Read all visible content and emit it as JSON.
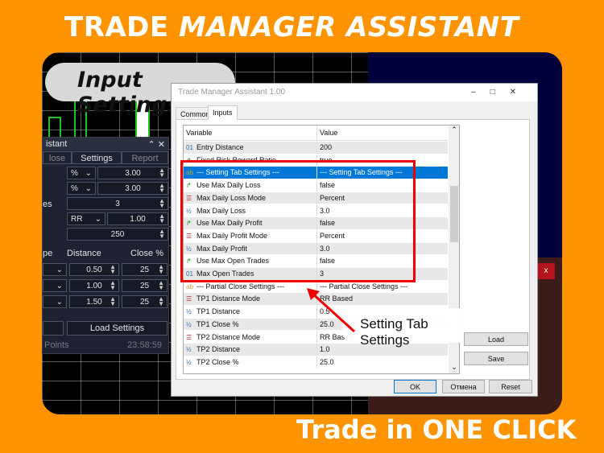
{
  "header": {
    "title_a": "TRADE",
    "title_b": "MANAGER ASSISTANT"
  },
  "footer": {
    "tagline": "Trade in ONE CLICK"
  },
  "badge": {
    "label": "Input Settings"
  },
  "callout": {
    "label": "Setting Tab Settings"
  },
  "colors": {
    "background": "#FF9400",
    "highlight": "#EE0000",
    "selected_row": "#0078D7"
  },
  "left_panel": {
    "title": "istant",
    "tabs": [
      "lose",
      "Settings",
      "Report"
    ],
    "rows": [
      {
        "label": "",
        "mode": "%",
        "value": "3.00"
      },
      {
        "label": "",
        "mode": "%",
        "value": "3.00"
      },
      {
        "label": "es",
        "mode": "",
        "value": "3"
      },
      {
        "label": "",
        "mode": "RR",
        "value": "1.00"
      },
      {
        "label": "",
        "mode": "",
        "value": "250"
      }
    ],
    "tp_header": [
      "pe",
      "Distance",
      "Close %"
    ],
    "tp_rows": [
      {
        "distance": "0.50",
        "close": "25"
      },
      {
        "distance": "1.00",
        "close": "25"
      },
      {
        "distance": "1.50",
        "close": "25"
      }
    ],
    "load_button": "Load Settings",
    "footer_left": "Points",
    "footer_time": "23:58:59"
  },
  "dialog": {
    "title": "Trade Manager Assistant 1.00",
    "tabs": [
      "Common",
      "Inputs"
    ],
    "columns": [
      "Variable",
      "Value"
    ],
    "rows": [
      {
        "icon": "01",
        "name": "Entry Distance",
        "value": "200"
      },
      {
        "icon": "bool",
        "name": "Fixed Risk Reward Ratio",
        "value": "true"
      },
      {
        "icon": "ab",
        "name": "--- Setting Tab Settings ---",
        "value": "--- Setting Tab Settings ---",
        "selected": true
      },
      {
        "icon": "bool",
        "name": "Use Max Daily Loss",
        "value": "false"
      },
      {
        "icon": "enum",
        "name": "Max Daily Loss Mode",
        "value": "Percent"
      },
      {
        "icon": "half",
        "name": "Max Daily Loss",
        "value": "3.0"
      },
      {
        "icon": "bool",
        "name": "Use Max Daily Profit",
        "value": "false"
      },
      {
        "icon": "enum",
        "name": "Max Daily Profit Mode",
        "value": "Percent"
      },
      {
        "icon": "half",
        "name": "Max Daily Profit",
        "value": "3.0"
      },
      {
        "icon": "bool",
        "name": "Use Max Open Trades",
        "value": "false"
      },
      {
        "icon": "01",
        "name": "Max Open Trades",
        "value": "3"
      },
      {
        "icon": "ab",
        "name": "--- Partial Close Settings ---",
        "value": "--- Partial Close Settings ---"
      },
      {
        "icon": "enum",
        "name": "TP1 Distance Mode",
        "value": "RR Based"
      },
      {
        "icon": "half",
        "name": "TP1 Distance",
        "value": "0.5"
      },
      {
        "icon": "half",
        "name": "TP1 Close %",
        "value": "25.0"
      },
      {
        "icon": "enum",
        "name": "TP2 Distance Mode",
        "value": "RR Based"
      },
      {
        "icon": "half",
        "name": "TP2 Distance",
        "value": "1.0"
      },
      {
        "icon": "half",
        "name": "TP2 Close %",
        "value": "25.0"
      }
    ],
    "load": "Load",
    "save": "Save",
    "ok": "OK",
    "cancel": "Отмена",
    "reset": "Reset"
  },
  "chart": {
    "close_button": "x"
  }
}
